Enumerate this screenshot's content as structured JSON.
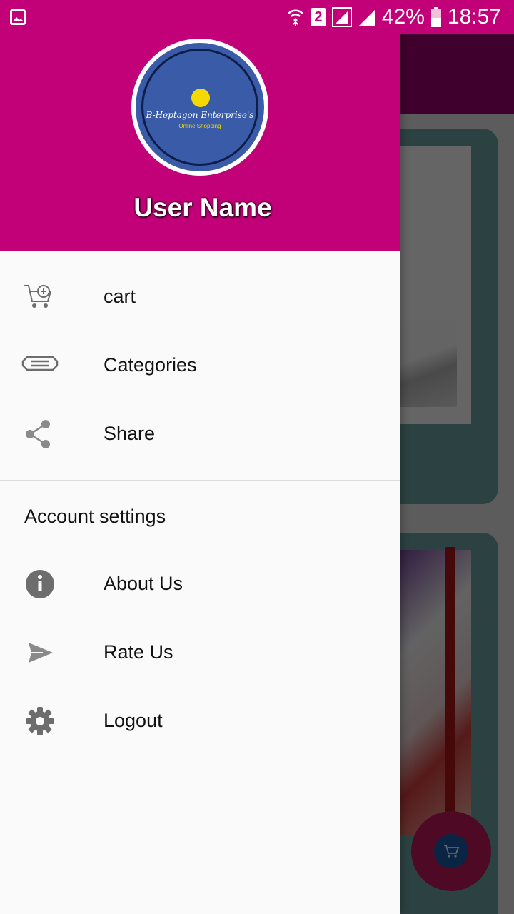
{
  "status_bar": {
    "battery": "42%",
    "time": "18:57",
    "sim_slot": "2",
    "icons": [
      "gallery-notification-icon",
      "wifi-hotspot-icon",
      "sim-icon",
      "signal-icon",
      "battery-icon"
    ]
  },
  "drawer": {
    "header": {
      "logo_text": "B-Heptagon Enterprise's",
      "logo_subtext": "Online Shopping",
      "user_name": "User Name"
    },
    "items": [
      {
        "label": "cart",
        "icon": "cart-plus-icon"
      },
      {
        "label": "Categories",
        "icon": "categories-icon"
      },
      {
        "label": "Share",
        "icon": "share-icon"
      }
    ],
    "section_title": "Account settings",
    "settings_items": [
      {
        "label": "About Us",
        "icon": "info-icon"
      },
      {
        "label": "Rate Us",
        "icon": "send-icon"
      },
      {
        "label": "Logout",
        "icon": "gear-icon"
      }
    ]
  },
  "colors": {
    "primary": "#c20078",
    "drawer_bg": "#fafafa",
    "icon_gray": "#6d6d6d"
  }
}
